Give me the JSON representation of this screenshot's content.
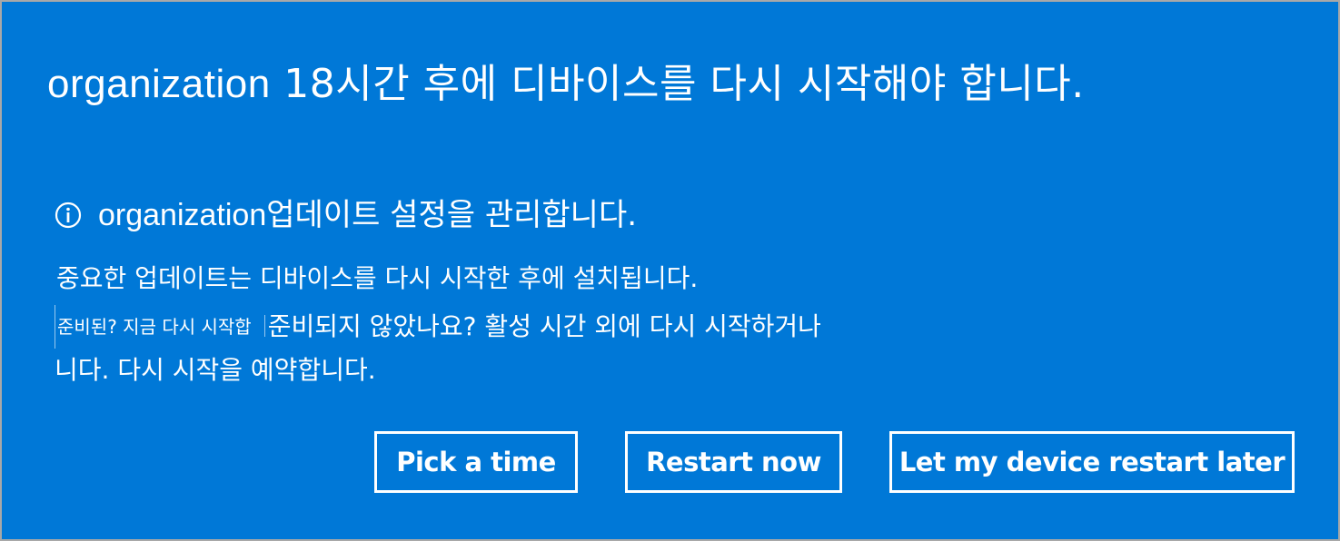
{
  "title": {
    "lead": "organization",
    "text": " 18시간 후에 디바이스를 다시 시작해야 합니다."
  },
  "info": {
    "icon": "info-icon",
    "lead": "organization",
    "text": " 업데이트 설정을 관리합니다."
  },
  "description": {
    "line1": "중요한 업데이트는 디바이스를 다시 시작한 후에 설치됩니다.",
    "small_text": "준비된? 지금 다시 시작합",
    "line2": "준비되지 않았나요? 활성 시간 외에 다시 시작하거나",
    "line3": "니다. 다시 시작을 예약합니다."
  },
  "buttons": {
    "pick_time": "Pick a time",
    "restart_now": "Restart now",
    "restart_later": "Let my device restart later"
  },
  "colors": {
    "background": "#0078d7",
    "text": "#ffffff",
    "border": "#a8a8a8"
  }
}
